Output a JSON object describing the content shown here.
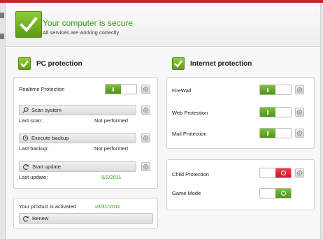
{
  "status": {
    "title": "Your computer is secure",
    "subtitle": "All services are working correctly"
  },
  "pc_protection": {
    "title": "PC protection",
    "realtime_label": "Realtime Protection",
    "realtime_enabled": true,
    "scan_button": "Scan system",
    "last_scan_label": "Last scan:",
    "last_scan_value": "Not performed",
    "backup_button": "Execute backup",
    "last_backup_label": "Last backup:",
    "last_backup_value": "Not performed",
    "update_button": "Start update",
    "last_update_label": "Last update:",
    "last_update_value": "9/2/2011"
  },
  "activation": {
    "label": "Your product is activated",
    "date": "10/31/2011",
    "renew_button": "Renew"
  },
  "internet_protection": {
    "title": "Internet protection",
    "items": [
      {
        "label": "FireWall",
        "enabled": true
      },
      {
        "label": "Web Protection",
        "enabled": true
      },
      {
        "label": "Mail Protection",
        "enabled": true
      }
    ]
  },
  "extras": {
    "items": [
      {
        "label": "Child Protection",
        "enabled": false
      },
      {
        "label": "Game Mode",
        "enabled": true
      }
    ]
  },
  "colors": {
    "accent_green": "#5f9d17",
    "ok_text_green": "#2f9a10",
    "off_red": "#d21f2e",
    "top_bar": "#c0282c"
  },
  "icons": {
    "status": "checkmark-icon",
    "settings": "gear-icon",
    "scan": "magnifier-icon",
    "backup": "clock-arrow-icon",
    "update": "refresh-icon",
    "renew": "refresh-icon"
  }
}
